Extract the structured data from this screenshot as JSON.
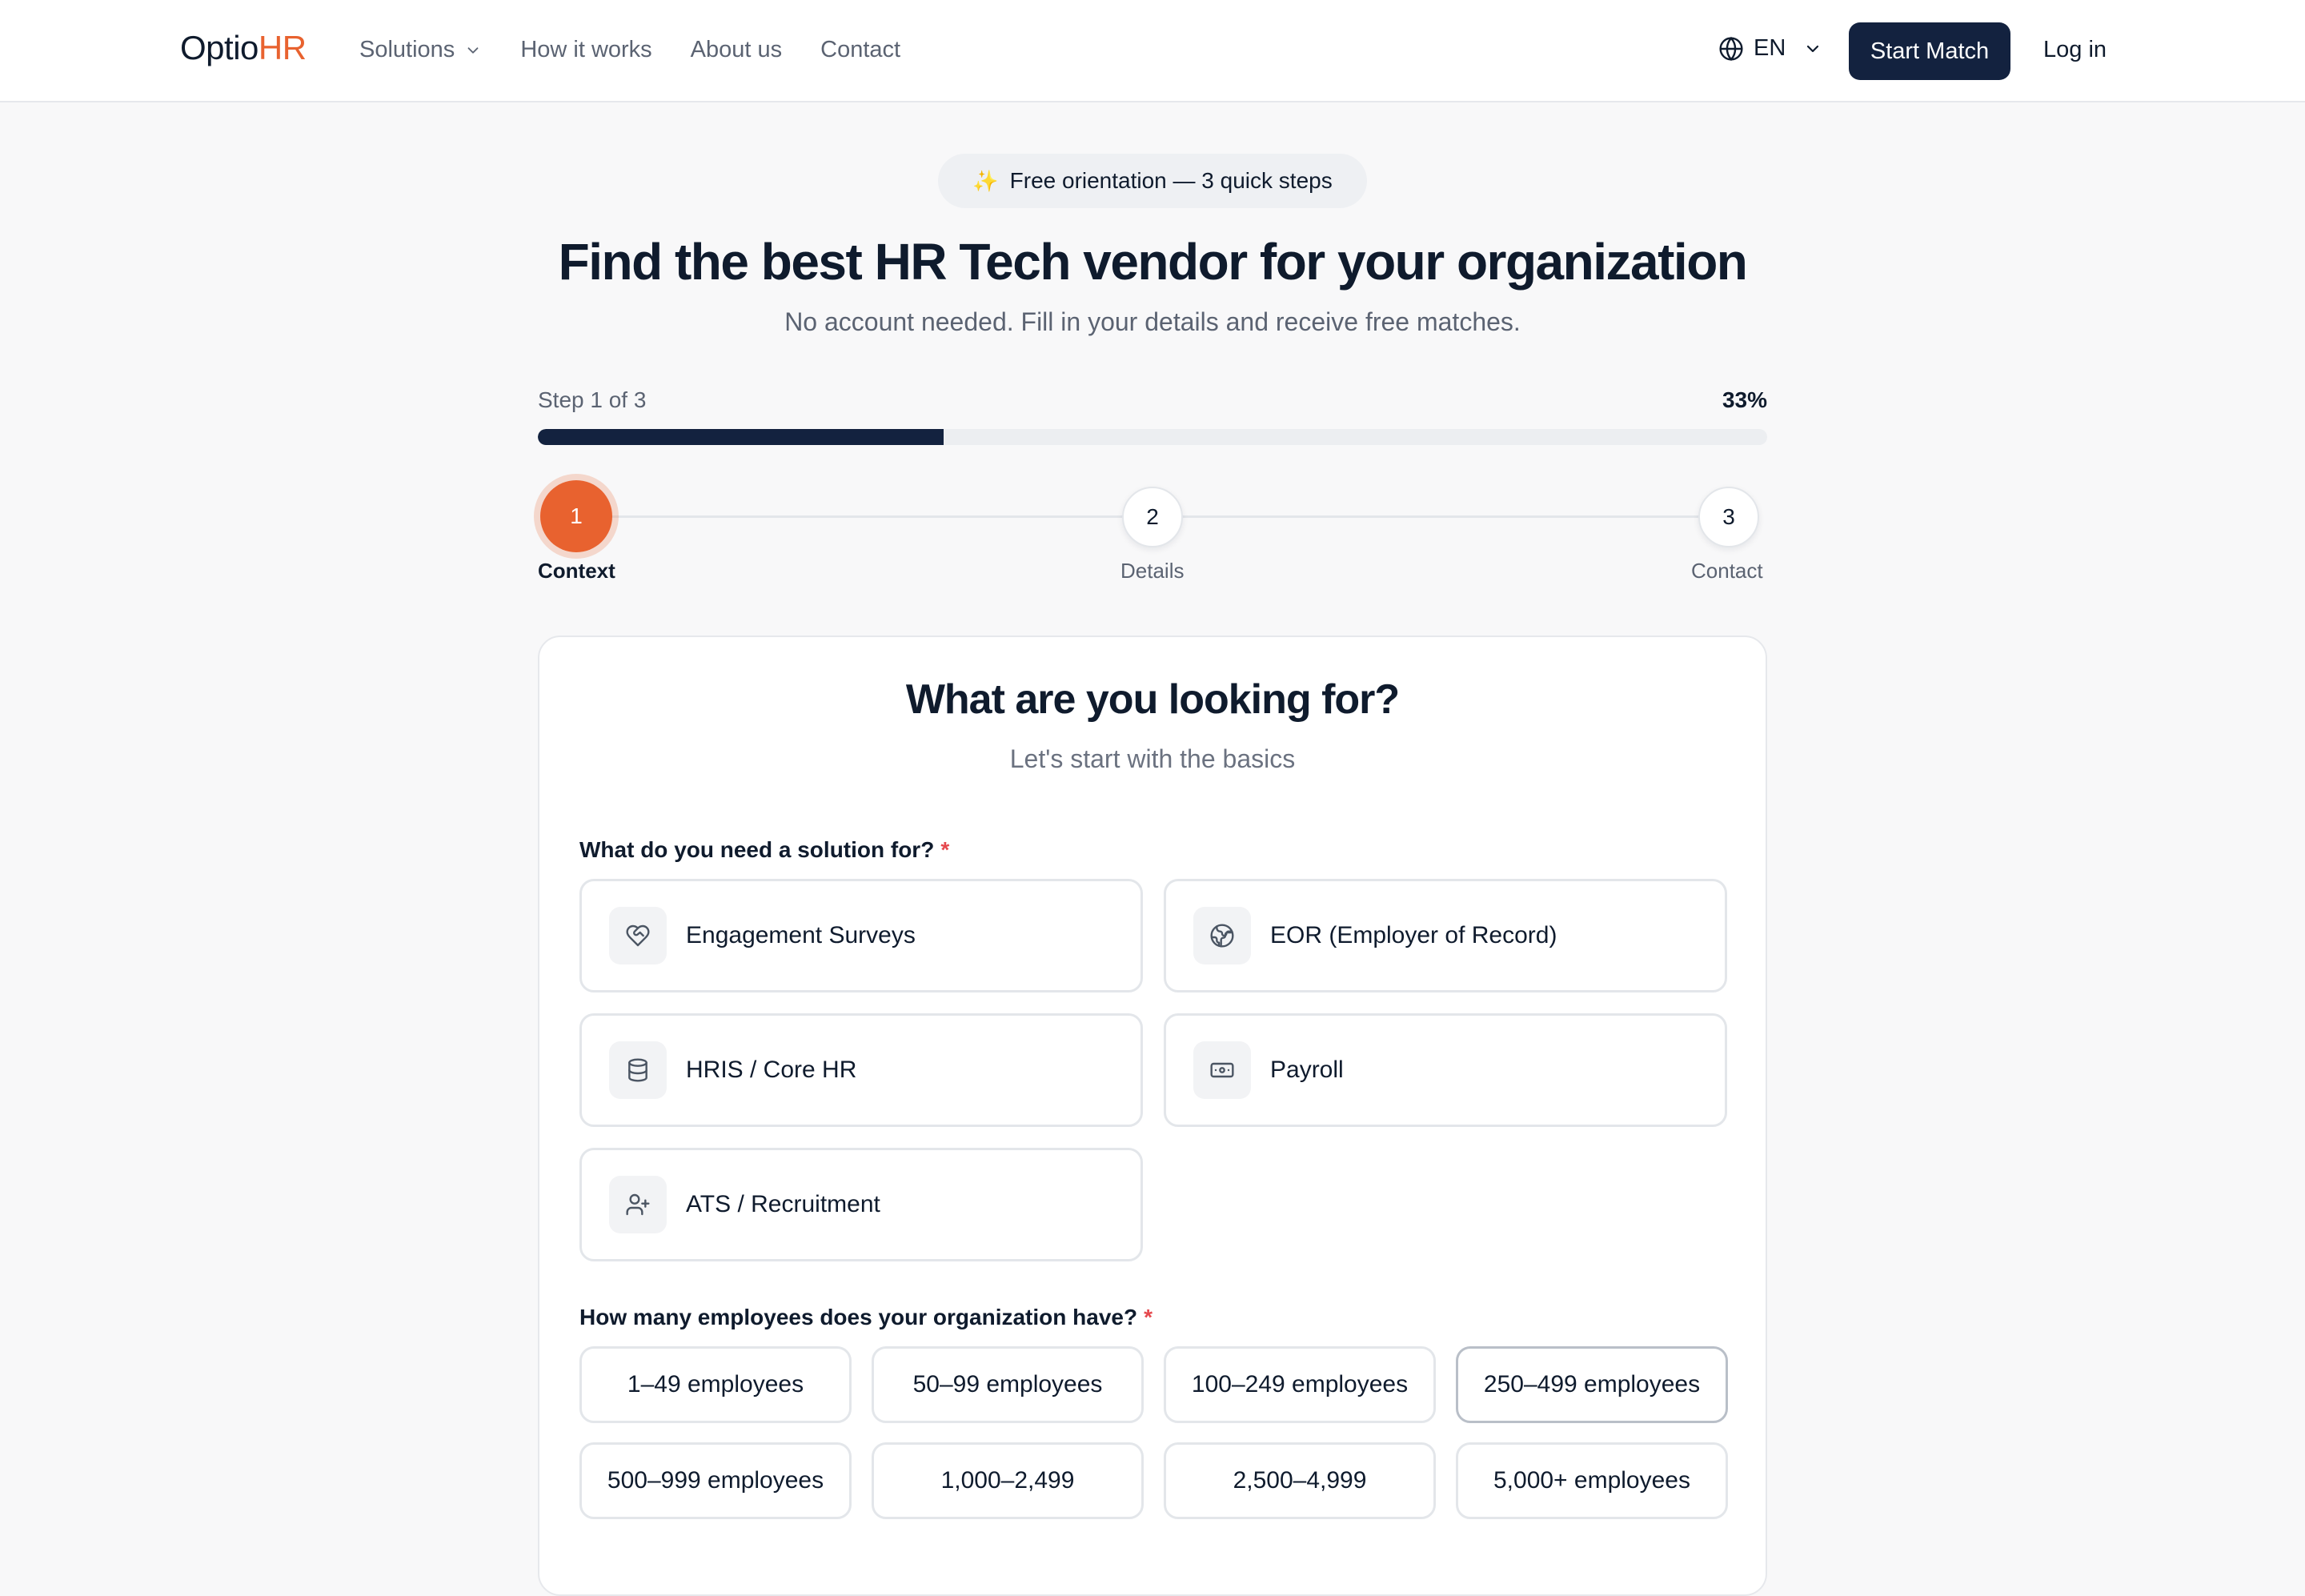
{
  "header": {
    "logo_part1": "Optio",
    "logo_part2": "HR",
    "nav": [
      "Solutions",
      "How it works",
      "About us",
      "Contact"
    ],
    "language": "EN",
    "start_button": "Start Match",
    "login": "Log in"
  },
  "hero": {
    "badge_icon": "sparkles-icon",
    "badge": "Free orientation — 3 quick steps",
    "title": "Find the best HR Tech vendor for your organization",
    "subtitle": "No account needed. Fill in your details and receive free matches."
  },
  "progress": {
    "label": "Step 1 of 3",
    "percent_text": "33%",
    "value": 0.33,
    "steps": [
      {
        "number": "1",
        "name": "Context",
        "active": true
      },
      {
        "number": "2",
        "name": "Details",
        "active": false
      },
      {
        "number": "3",
        "name": "Contact",
        "active": false
      }
    ]
  },
  "form": {
    "title": "What are you looking for?",
    "subtitle": "Let's start with the basics",
    "q1": {
      "label": "What do you need a solution for?",
      "required": "*",
      "options": [
        {
          "label": "Engagement Surveys",
          "icon": "heart-handshake-icon"
        },
        {
          "label": "EOR (Employer of Record)",
          "icon": "globe-icon"
        },
        {
          "label": "HRIS / Core HR",
          "icon": "database-icon"
        },
        {
          "label": "Payroll",
          "icon": "banknote-icon"
        },
        {
          "label": "ATS / Recruitment",
          "icon": "user-plus-icon"
        }
      ]
    },
    "q2": {
      "label": "How many employees does your organization have?",
      "required": "*",
      "options": [
        "1–49 employees",
        "50–99 employees",
        "100–249 employees",
        "250–499 employees",
        "500–999 employees",
        "1,000–2,499",
        "2,500–4,999",
        "5,000+ employees"
      ]
    }
  },
  "colors": {
    "brand_navy": "#13223f",
    "accent_orange": "#e8622f",
    "required_red": "#e5484d"
  }
}
